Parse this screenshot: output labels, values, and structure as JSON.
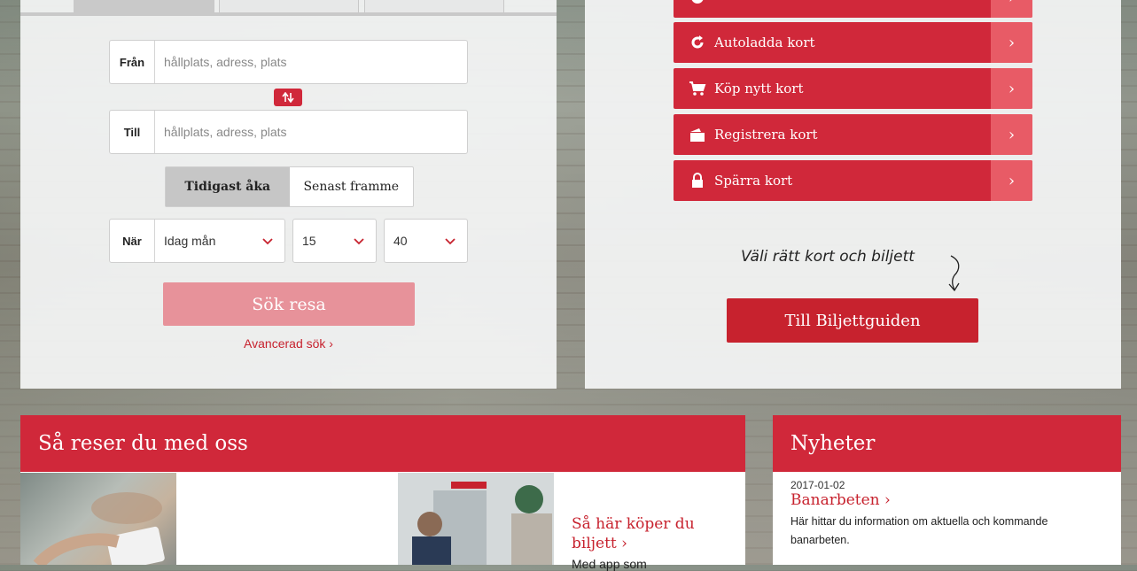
{
  "trip_planner": {
    "from_label": "Från",
    "from_placeholder": "hållplats, adress, plats",
    "swap_icon": "swap-arrows-icon",
    "to_label": "Till",
    "to_placeholder": "hållplats, adress, plats",
    "mode_earliest": "Tidigast åka",
    "mode_latest": "Senast framme",
    "when_label": "När",
    "day_value": "Idag mån",
    "hour_value": "15",
    "minute_value": "40",
    "search_button": "Sök resa",
    "advanced_link": "Avancerad sök ›"
  },
  "card_menu": {
    "items": [
      {
        "label": "Autoladda kort",
        "icon": "refresh-icon"
      },
      {
        "label": "Köp nytt kort",
        "icon": "cart-icon"
      },
      {
        "label": "Registrera kort",
        "icon": "card-register-icon"
      },
      {
        "label": "Spärra kort",
        "icon": "lock-icon"
      }
    ],
    "arrow": "›",
    "handwritten_hint": "Väli rätt kort och biljett",
    "guide_button": "Till Biljettguiden"
  },
  "travel_section": {
    "heading": "Så reser du med oss",
    "tip_title": "Så här köper du biljett ›",
    "tip_sub": "Med app som"
  },
  "news_section": {
    "heading": "Nyheter",
    "date": "2017-01-02",
    "title": "Banarbeten ›",
    "text": "Här hittar du information om aktuella och kommande banarbeten."
  },
  "colors": {
    "brand_red": "#d0283a",
    "arrow_red": "#e85b66",
    "disabled_button": "#e7929a"
  }
}
